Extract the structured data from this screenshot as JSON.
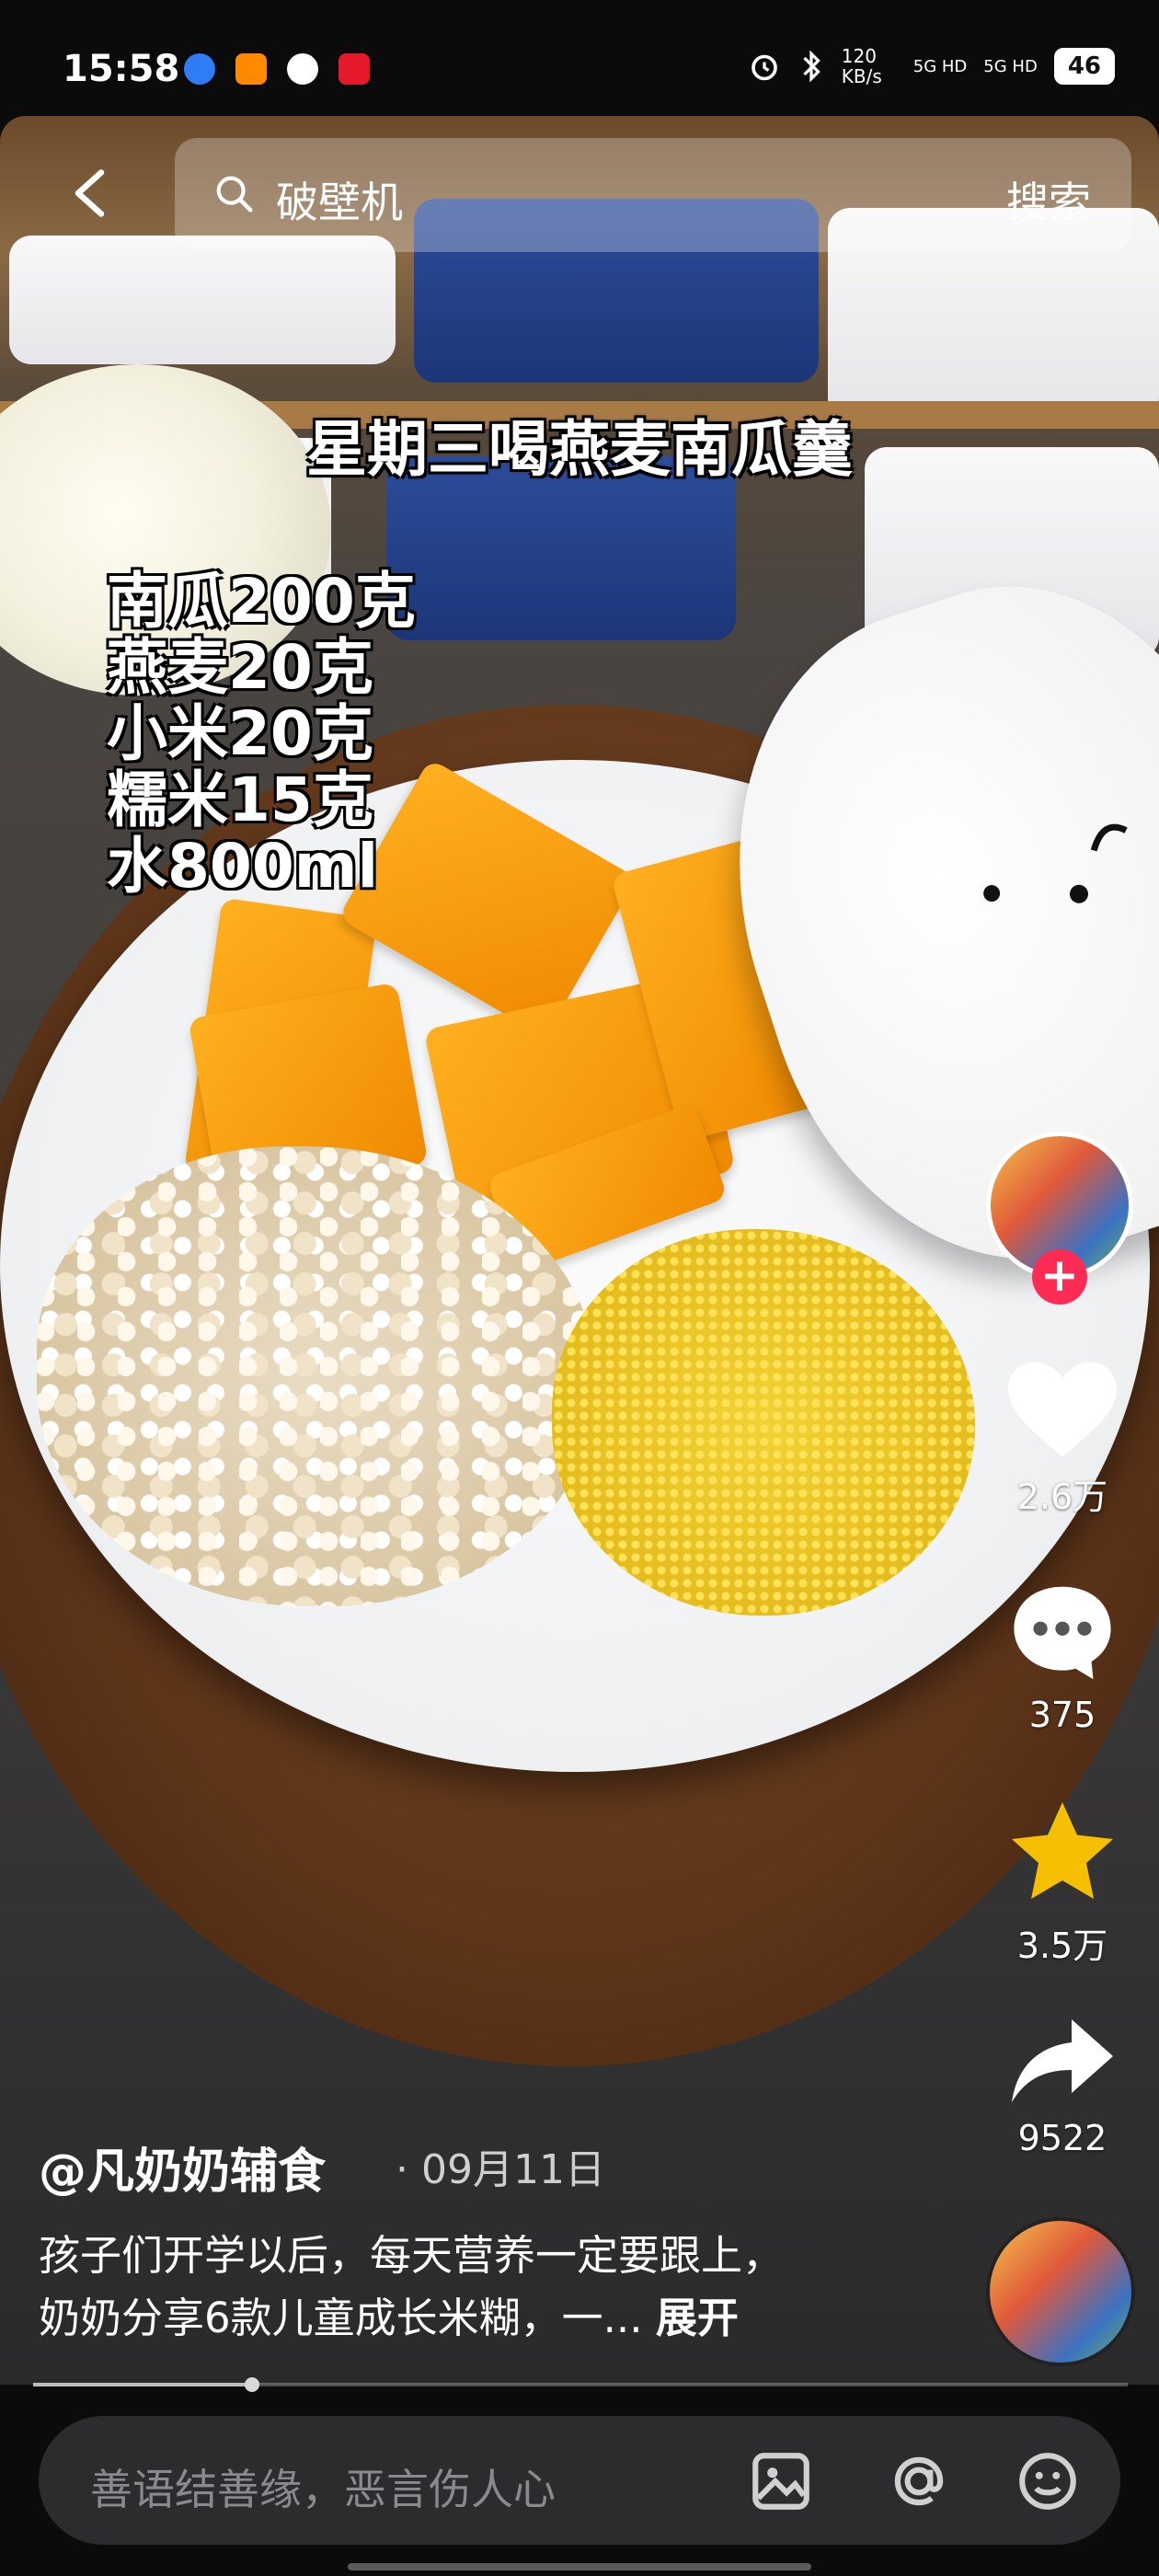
{
  "status_bar": {
    "time": "15:58",
    "network_speed": "120 KB/s",
    "signal_1": "5G HD",
    "signal_2": "5G HD",
    "battery": "46"
  },
  "search": {
    "query": "破壁机",
    "submit_label": "搜索"
  },
  "video": {
    "headline": "星期三喝燕麦南瓜羹",
    "recipe_lines": [
      "南瓜200克",
      "燕麦20克",
      "小米20克",
      "糯米15克",
      "水800ml"
    ]
  },
  "actions": {
    "likes": "2.6万",
    "comments": "375",
    "favorites": "3.5万",
    "shares": "9522"
  },
  "post": {
    "author": "@凡奶奶辅食",
    "date": "09月11日",
    "description_line1": "孩子们开学以后，每天营养一定要跟上，",
    "description_line2": "奶奶分享6款儿童成长米糊，一...",
    "expand_label": "展开"
  },
  "progress": {
    "played_fraction": 0.2
  },
  "comment_bar": {
    "placeholder": "善语结善缘，恶言伤人心"
  },
  "colors": {
    "accent": "#fe2c55",
    "favorite": "#f6c000",
    "like": "#ffffff"
  }
}
